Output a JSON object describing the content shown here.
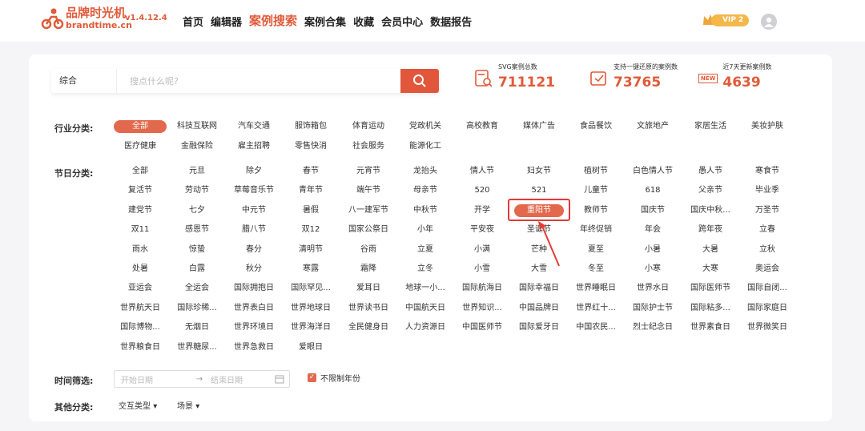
{
  "brand": {
    "name_cn": "品牌时光机",
    "name_en": "brandtime.cn",
    "version": "v1.4.12.4"
  },
  "nav": [
    "首页",
    "编辑器",
    "案例搜索",
    "案例合集",
    "收藏",
    "会员中心",
    "数据报告"
  ],
  "vip_label": "VIP 2",
  "search": {
    "type": "综合",
    "placeholder": "搜点什么呢?"
  },
  "stats": [
    {
      "label": "SVG案例总数",
      "value": "711121"
    },
    {
      "label": "支持一键还原的案例数",
      "value": "73765"
    },
    {
      "label": "近7天更新案例数",
      "value": "4639",
      "badge": "NEW"
    }
  ],
  "industry": {
    "label": "行业分类:",
    "items": [
      "全部",
      "科技互联网",
      "汽车交通",
      "服饰箱包",
      "体育运动",
      "党政机关",
      "高校教育",
      "媒体广告",
      "食品餐饮",
      "文旅地产",
      "家居生活",
      "美妆护肤",
      "医疗健康",
      "金融保险",
      "雇主招聘",
      "零售快消",
      "社会服务",
      "能源化工"
    ]
  },
  "festival": {
    "label": "节日分类:",
    "items": [
      "全部",
      "元旦",
      "除夕",
      "春节",
      "元宵节",
      "龙抬头",
      "情人节",
      "妇女节",
      "植树节",
      "白色情人节",
      "愚人节",
      "寒食节",
      "复活节",
      "劳动节",
      "草莓音乐节",
      "青年节",
      "端午节",
      "母亲节",
      "520",
      "521",
      "儿童节",
      "618",
      "父亲节",
      "毕业季",
      "建党节",
      "七夕",
      "中元节",
      "暑假",
      "八一建军节",
      "中秋节",
      "开学",
      "重阳节",
      "教师节",
      "国庆节",
      "国庆中秋...",
      "万圣节",
      "双11",
      "感恩节",
      "腊八节",
      "双12",
      "国家公祭日",
      "小年",
      "平安夜",
      "圣诞节",
      "年终促销",
      "年会",
      "跨年夜",
      "立春",
      "雨水",
      "惊蛰",
      "春分",
      "清明节",
      "谷雨",
      "立夏",
      "小满",
      "芒种",
      "夏至",
      "小暑",
      "大暑",
      "立秋",
      "处暑",
      "白露",
      "秋分",
      "寒露",
      "霜降",
      "立冬",
      "小雪",
      "大雪",
      "冬至",
      "小寒",
      "大寒",
      "奥运会",
      "亚运会",
      "全运会",
      "国际拥抱日",
      "国际罕见...",
      "爱耳日",
      "地球一小...",
      "国际航海日",
      "国际幸福日",
      "世界睡眠日",
      "世界水日",
      "国际医师节",
      "国际自闭...",
      "世界航天日",
      "国际珍稀...",
      "世界表白日",
      "世界地球日",
      "世界读书日",
      "中国航天日",
      "世界知识...",
      "中国品牌日",
      "世界红十...",
      "国际护士节",
      "国际粘多...",
      "国际家庭日",
      "国际博物...",
      "无烟日",
      "世界环境日",
      "世界海洋日",
      "全民健身日",
      "人力资源日",
      "中国医师节",
      "国际爱牙日",
      "中国农民...",
      "烈士纪念日",
      "世界素食日",
      "世界微笑日",
      "世界粮食日",
      "世界糖尿...",
      "世界急救日",
      "爱眼日"
    ]
  },
  "time_filter": {
    "label": "时间筛选:",
    "start": "开始日期",
    "arrow": "→",
    "end": "结束日期",
    "checkbox": "不限制年份"
  },
  "other": {
    "label": "其他分类:",
    "dropdowns": [
      "交互类型",
      "场景"
    ]
  },
  "colors": {
    "accent": "#e05a3a",
    "highlight": "#e53935"
  }
}
